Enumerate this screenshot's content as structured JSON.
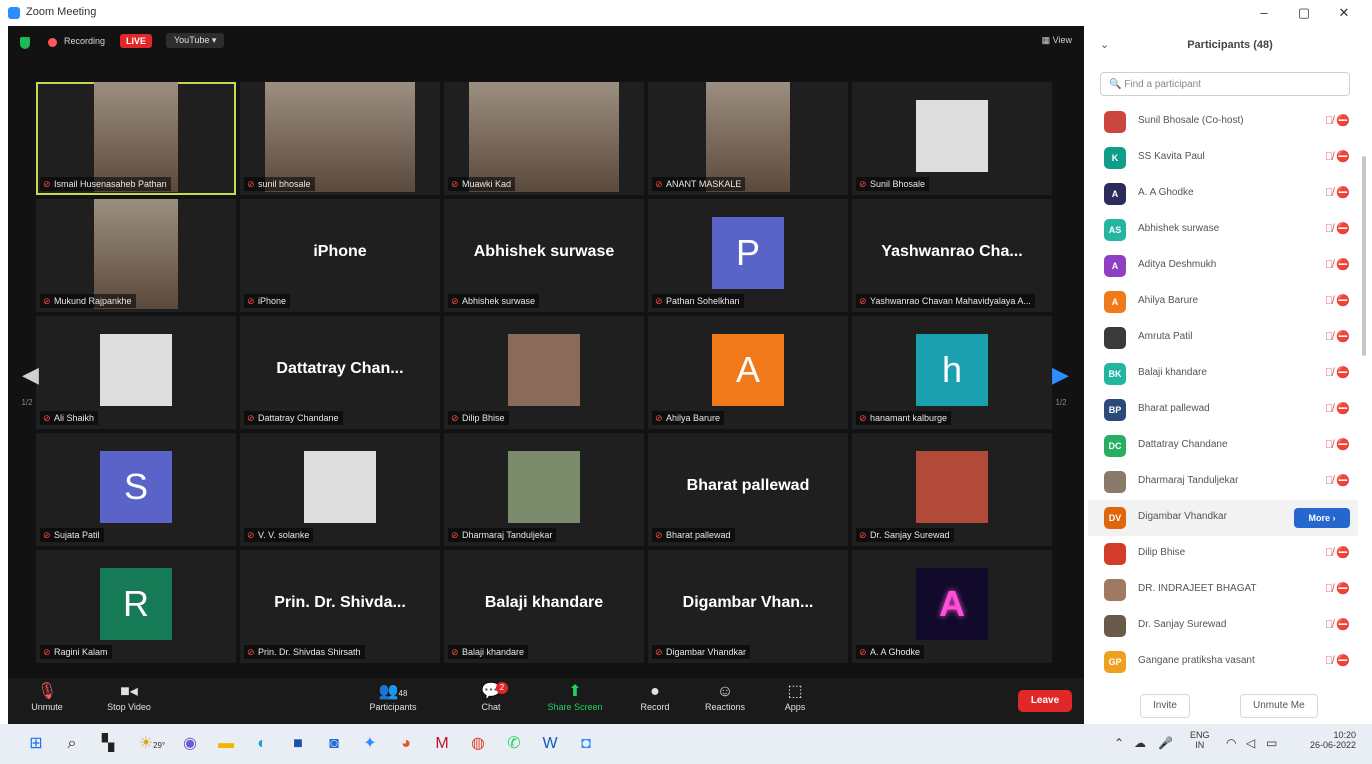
{
  "window": {
    "title": "Zoom Meeting",
    "controls": [
      "–",
      "▢",
      "✕"
    ]
  },
  "topbar": {
    "recording": "Recording",
    "live": "LIVE",
    "youtube": "YouTube ▾",
    "view": "View"
  },
  "tiles": [
    {
      "name": "Ismail Husenasaheb Pathan",
      "kind": "video"
    },
    {
      "name": "sunil bhosale",
      "kind": "video"
    },
    {
      "name": "Muawki Kad",
      "kind": "video"
    },
    {
      "name": "ANANT MASKALE",
      "kind": "video"
    },
    {
      "name": "Sunil Bhosale",
      "kind": "photo"
    },
    {
      "name": "Mukund Rajpankhe",
      "kind": "video"
    },
    {
      "name": "iPhone",
      "kind": "text",
      "big": "iPhone"
    },
    {
      "name": "Abhishek surwase",
      "kind": "text",
      "big": "Abhishek surwase"
    },
    {
      "name": "Pathan Sohelkhan",
      "kind": "letter",
      "letter": "P",
      "color": "#5a64c8"
    },
    {
      "name": "Yashwanrao Chavan Mahavidyalaya A...",
      "kind": "text",
      "big": "Yashwanrao  Cha..."
    },
    {
      "name": "Ali Shaikh",
      "kind": "photo"
    },
    {
      "name": "Dattatray Chandane",
      "kind": "text",
      "big": "Dattatray  Chan..."
    },
    {
      "name": "Dilip Bhise",
      "kind": "photo"
    },
    {
      "name": "Ahilya Barure",
      "kind": "letter",
      "letter": "A",
      "color": "#f07a1a"
    },
    {
      "name": "hanamant kalburge",
      "kind": "letter",
      "letter": "h",
      "color": "#1ba0b0"
    },
    {
      "name": "Sujata Patil",
      "kind": "letter",
      "letter": "S",
      "color": "#5a64c8"
    },
    {
      "name": "V. V. solanke",
      "kind": "photo"
    },
    {
      "name": "Dharmaraj Tanduljekar",
      "kind": "photo"
    },
    {
      "name": "Bharat pallewad",
      "kind": "text",
      "big": "Bharat  pallewad"
    },
    {
      "name": "Dr. Sanjay Surewad",
      "kind": "photo"
    },
    {
      "name": "Ragini Kalam",
      "kind": "letter",
      "letter": "R",
      "color": "#157a55"
    },
    {
      "name": "Prin. Dr. Shivdas Shirsath",
      "kind": "text",
      "big": "Prin.  Dr.  Shivda..."
    },
    {
      "name": "Balaji khandare",
      "kind": "text",
      "big": "Balaji  khandare"
    },
    {
      "name": "Digambar Vhandkar",
      "kind": "text",
      "big": "Digambar  Vhan..."
    },
    {
      "name": "A. A Ghodke",
      "kind": "neon"
    }
  ],
  "pager": {
    "left": "1/2",
    "right": "1/2"
  },
  "toolbar": {
    "unmute": "Unmute",
    "stop_video": "Stop Video",
    "participants": "Participants",
    "participants_count": "48",
    "chat": "Chat",
    "chat_badge": "2",
    "share": "Share Screen",
    "record": "Record",
    "reactions": "Reactions",
    "apps": "Apps",
    "leave": "Leave"
  },
  "panel": {
    "title": "Participants (48)",
    "search_placeholder": "Find a participant",
    "more": "More ›",
    "invite": "Invite",
    "unmute_me": "Unmute Me",
    "participants": [
      {
        "name": "Sunil Bhosale (Co-host)",
        "initials": "",
        "color": "#c9473c"
      },
      {
        "name": "SS Kavita Paul",
        "initials": "K",
        "color": "#0e9e8a"
      },
      {
        "name": "A. A Ghodke",
        "initials": "A",
        "color": "#2b2b5c"
      },
      {
        "name": "Abhishek surwase",
        "initials": "AS",
        "color": "#23b5a0"
      },
      {
        "name": "Aditya Deshmukh",
        "initials": "A",
        "color": "#8e3fc2"
      },
      {
        "name": "Ahilya Barure",
        "initials": "A",
        "color": "#f07a1a"
      },
      {
        "name": "Amruta Patil",
        "initials": "",
        "color": "#3a3a3a"
      },
      {
        "name": "Balaji khandare",
        "initials": "BK",
        "color": "#23b5a0"
      },
      {
        "name": "Bharat pallewad",
        "initials": "BP",
        "color": "#2b4a7a"
      },
      {
        "name": "Dattatray Chandane",
        "initials": "DC",
        "color": "#27ae60"
      },
      {
        "name": "Dharmaraj Tanduljekar",
        "initials": "",
        "color": "#8a7a6a"
      },
      {
        "name": "Digambar Vhandkar",
        "initials": "DV",
        "color": "#e0660c"
      },
      {
        "name": "Dilip Bhise",
        "initials": "",
        "color": "#d23c2a"
      },
      {
        "name": "DR. INDRAJEET BHAGAT",
        "initials": "",
        "color": "#a07a60"
      },
      {
        "name": "Dr. Sanjay Surewad",
        "initials": "",
        "color": "#6a5a4a"
      },
      {
        "name": "Gangane pratiksha vasant",
        "initials": "GP",
        "color": "#f0a020"
      }
    ]
  },
  "taskbar": {
    "weather": "29°",
    "lang1": "ENG",
    "lang2": "IN",
    "time": "10:20",
    "date": "26-06-2022"
  }
}
